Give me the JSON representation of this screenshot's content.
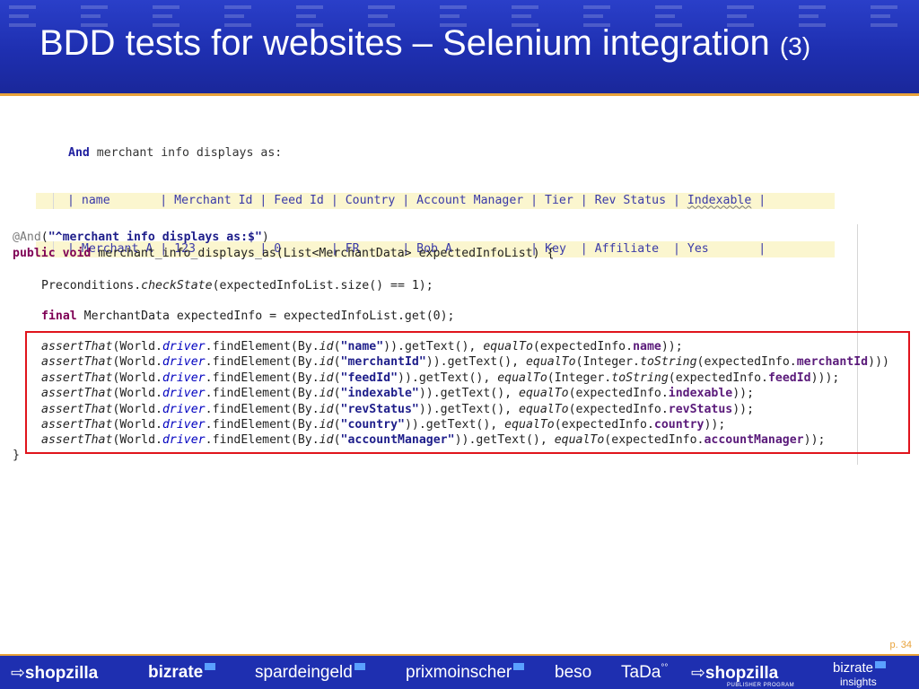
{
  "slide": {
    "title": "BDD tests for websites – Selenium integration",
    "title_suffix": "(3)",
    "page_number": "p. 34"
  },
  "gherkin": {
    "step_keyword": "And",
    "step_text": " merchant info displays as:",
    "headers": [
      "name",
      "Merchant Id",
      "Feed Id",
      "Country",
      "Account Manager",
      "Tier",
      "Rev Status",
      "Indexable"
    ],
    "row": [
      "Merchant A",
      "123",
      "0",
      "FR",
      "Bob A",
      "Key",
      "Affiliate",
      "Yes"
    ]
  },
  "java": {
    "annotation": "@And",
    "annotation_arg": "\"^merchant info displays as:$\"",
    "signature_kw": "public void",
    "signature_rest": " merchant_info_displays_as(List<MerchantData> expectedInfoList) {",
    "precondition_a": "Preconditions.",
    "precondition_method": "checkState",
    "precondition_b": "(expectedInfoList.size() == 1);",
    "final_kw": "final",
    "final_rest": " MerchantData expectedInfo = expectedInfoList.get(0);",
    "asserts": [
      {
        "id": "\"name\"",
        "mid": ")).getText(), ",
        "wrap": "",
        "prop": "name",
        "end": "));"
      },
      {
        "id": "\"merchantId\"",
        "mid": ")).getText(), ",
        "wrap": "Integer.toString",
        "prop": "merchantId",
        "end": ")))"
      },
      {
        "id": "\"feedId\"",
        "mid": ")).getText(), ",
        "wrap": "Integer.toString",
        "prop": "feedId",
        "end": ")));"
      },
      {
        "id": "\"indexable\"",
        "mid": ")).getText(), ",
        "wrap": "",
        "prop": "indexable",
        "end": "));"
      },
      {
        "id": "\"revStatus\"",
        "mid": ")).getText(), ",
        "wrap": "",
        "prop": "revStatus",
        "end": "));"
      },
      {
        "id": "\"country\"",
        "mid": ")).getText(), ",
        "wrap": "",
        "prop": "country",
        "end": "));"
      },
      {
        "id": "\"accountManager\"",
        "mid": ")).getText(), ",
        "wrap": "",
        "prop": "accountManager",
        "end": "));"
      }
    ],
    "assert_fn": "assertThat",
    "world": "(World.",
    "driver": "driver",
    "find": ".findElement(By.",
    "by_id": "id",
    "equal_to": "equalTo",
    "expected": "expectedInfo.",
    "closing_brace": "}"
  },
  "footer_logos": [
    {
      "name": "shopzilla",
      "text": "shopzilla"
    },
    {
      "name": "bizrate",
      "text": "bizrate"
    },
    {
      "name": "spardeingeld",
      "text": "spardeingeld"
    },
    {
      "name": "prixmoinscher",
      "text": "prixmoinscher"
    },
    {
      "name": "beso",
      "text": "beso"
    },
    {
      "name": "tada",
      "text": "TaDa"
    },
    {
      "name": "shopzilla-publisher",
      "text": "shopzilla",
      "sub": "PUBLISHER PROGRAM"
    },
    {
      "name": "bizrate-insights",
      "text": "bizrate",
      "sub": "insights"
    }
  ],
  "colors": {
    "header_blue": "#1e2fb0",
    "accent_orange": "#e8a23a",
    "highlight_red": "#e0141c",
    "table_highlight": "#fbf6cf"
  }
}
